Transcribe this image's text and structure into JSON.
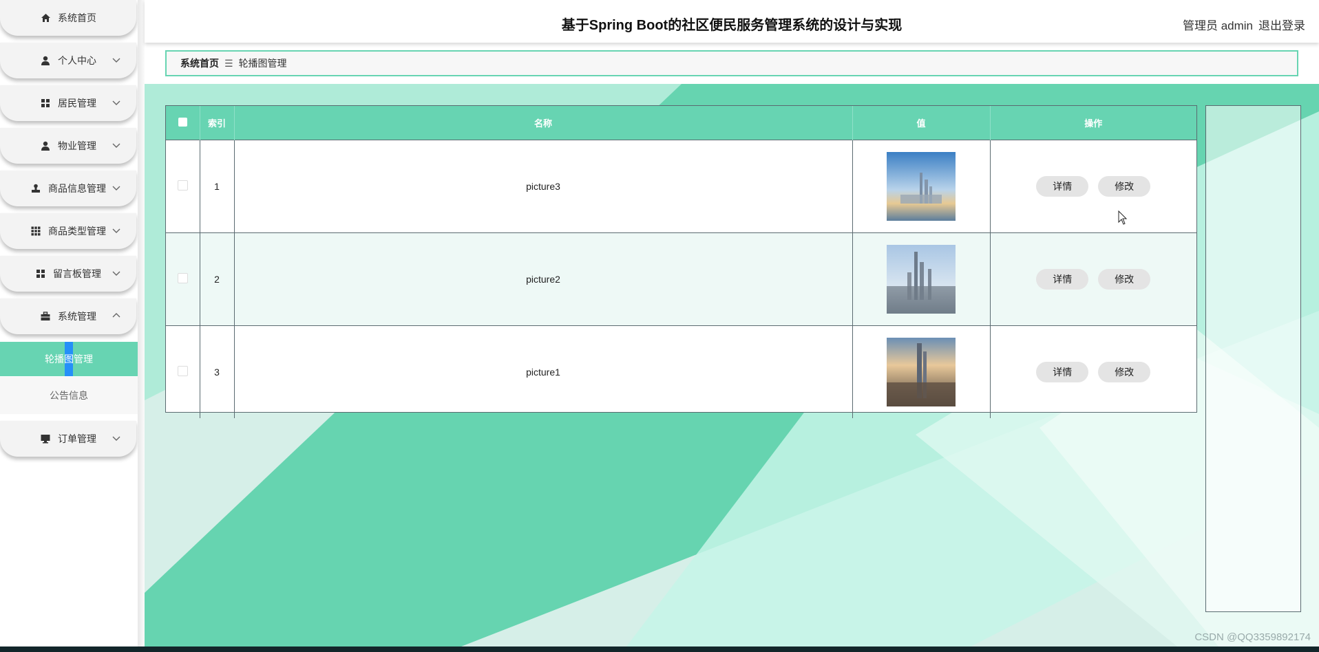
{
  "header": {
    "title": "基于Spring Boot的社区便民服务管理系统的设计与实现",
    "user_label": "管理员 admin",
    "logout_label": "退出登录"
  },
  "sidebar": {
    "items": [
      {
        "label": "系统首页",
        "icon": "home-icon"
      },
      {
        "label": "个人中心",
        "icon": "person-icon"
      },
      {
        "label": "居民管理",
        "icon": "grid-icon"
      },
      {
        "label": "物业管理",
        "icon": "person-icon"
      },
      {
        "label": "商品信息管理",
        "icon": "stamp-icon"
      },
      {
        "label": "商品类型管理",
        "icon": "grid9-icon"
      },
      {
        "label": "留言板管理",
        "icon": "grid-icon"
      },
      {
        "label": "系统管理",
        "icon": "briefcase-icon"
      },
      {
        "label": "订单管理",
        "icon": "monitor-icon"
      }
    ],
    "sub_items": [
      {
        "label": "轮播图管理",
        "active": true
      },
      {
        "label": "公告信息",
        "active": false
      }
    ]
  },
  "breadcrumb": {
    "home": "系统首页",
    "separator_icon": "menu-icon",
    "current": "轮播图管理"
  },
  "table": {
    "columns": [
      "索引",
      "名称",
      "值",
      "操作"
    ],
    "rows": [
      {
        "index": "1",
        "name": "picture3"
      },
      {
        "index": "2",
        "name": "picture2"
      },
      {
        "index": "3",
        "name": "picture1"
      }
    ],
    "detail_label": "详情",
    "edit_label": "修改"
  },
  "watermark": "CSDN @QQ3359892174",
  "colors": {
    "accent": "#67d4b2",
    "sidebar_active": "#67d4b2"
  }
}
